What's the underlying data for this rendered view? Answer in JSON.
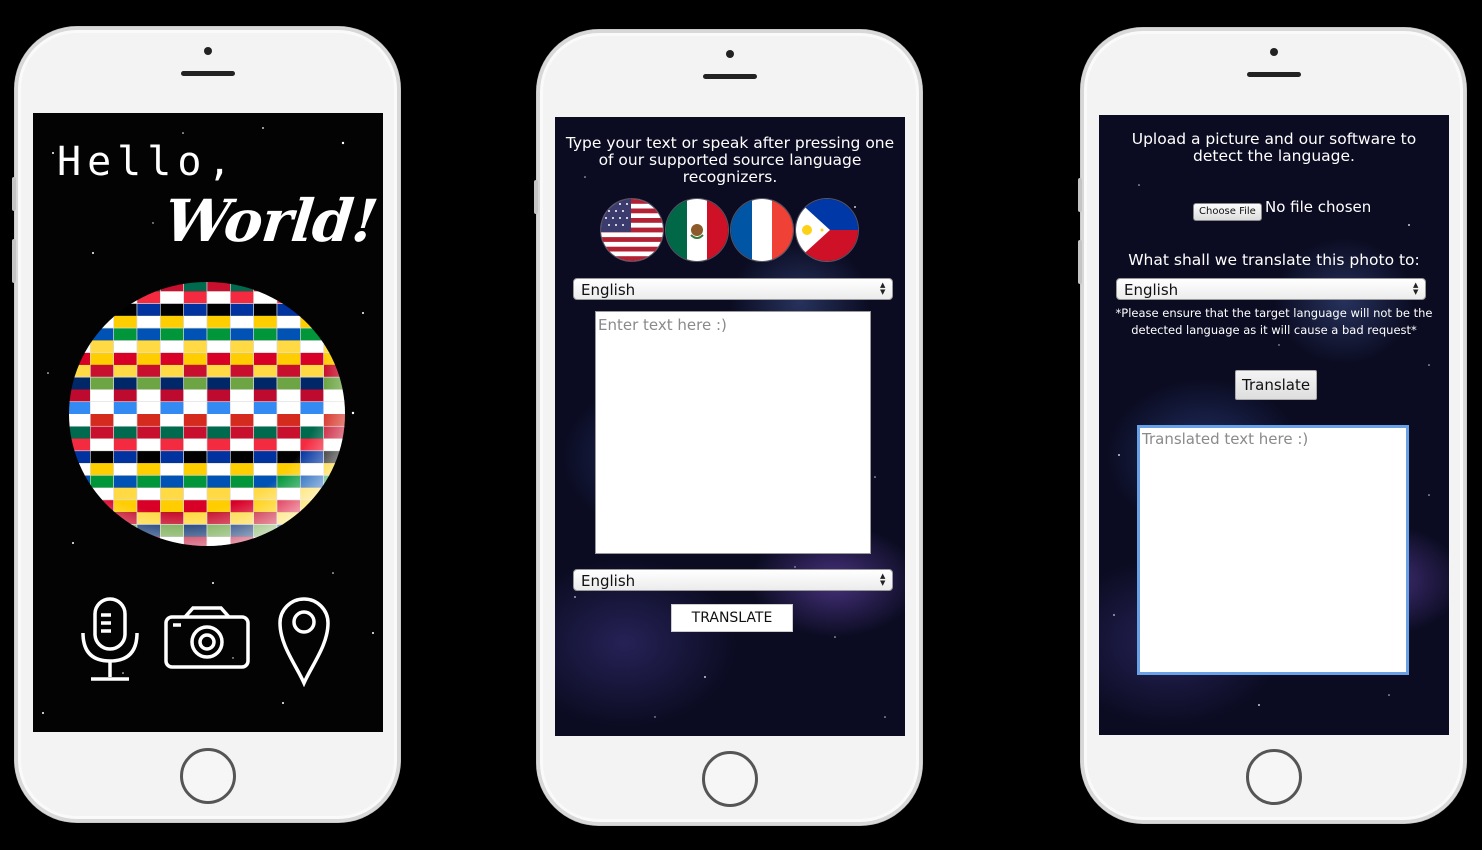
{
  "phone1": {
    "hello": "Hello,",
    "world": "World!",
    "icons": [
      "microphone-icon",
      "camera-icon",
      "location-pin-icon"
    ]
  },
  "phone2": {
    "instruction": "Type your text or speak after pressing one of our supported source language recognizers.",
    "flags": [
      "flag-usa",
      "flag-mexico",
      "flag-france",
      "flag-philippines"
    ],
    "source_select": "English",
    "text_placeholder": "Enter text here :)",
    "target_select": "English",
    "translate_button": "TRANSLATE"
  },
  "phone3": {
    "instruction": "Upload a picture and our software to detect the language.",
    "choose_file": "Choose File",
    "no_file": "No file chosen",
    "question": "What shall we translate this photo to:",
    "target_select": "English",
    "note": "*Please ensure that the target language will not be the detected language as it will cause a bad request*",
    "translate_button": "Translate",
    "output_placeholder": "Translated text here :)"
  },
  "colors": {
    "background": "#000000",
    "phone_body": "#f3f3f3",
    "focus_border": "#6aa0e6"
  }
}
